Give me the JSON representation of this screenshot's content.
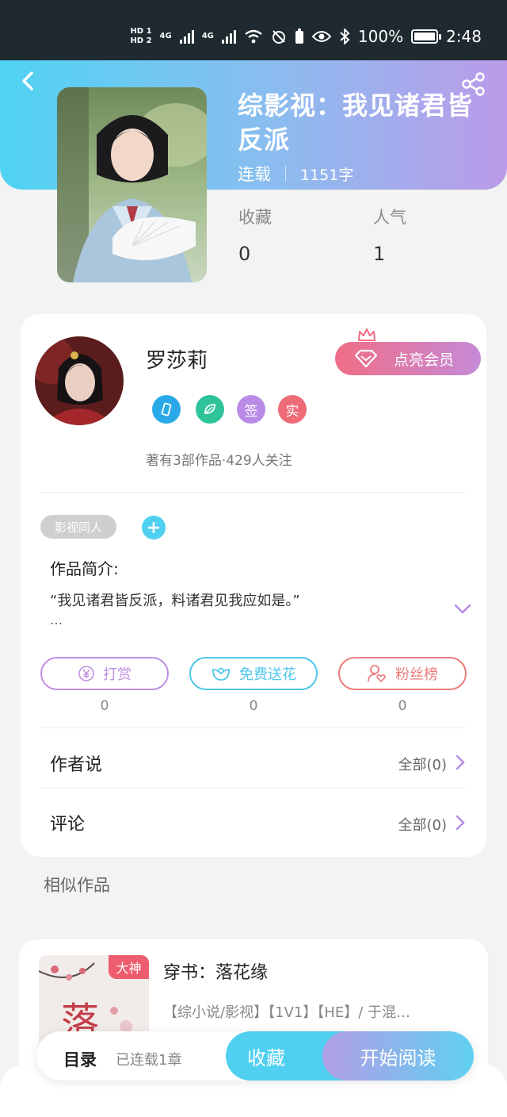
{
  "status_bar": {
    "sim1": "HD 1",
    "sim2": "HD 2",
    "net1": "4G",
    "net2": "4G",
    "battery": "100%",
    "time": "2:48"
  },
  "book": {
    "title": "综影视：我见诸君皆反派",
    "status": "连载",
    "words": "1151字",
    "stats": [
      {
        "label": "收藏",
        "value": "0"
      },
      {
        "label": "人气",
        "value": "1"
      }
    ]
  },
  "author": {
    "name": "罗莎莉",
    "vip_button": "点亮会员",
    "badges": [
      {
        "icon": "phone-badge-icon",
        "color": "#2aa9e8"
      },
      {
        "icon": "leaf-badge-icon",
        "color": "#2fc39a"
      },
      {
        "text": "签",
        "color": "#b98be6"
      },
      {
        "text": "实",
        "color": "#ee6b78"
      }
    ],
    "stats": "著有3部作品·429人关注"
  },
  "tags": [
    "影视同人"
  ],
  "intro": {
    "title": "作品简介:",
    "text": "“我见诸君皆反派，料诸君见我应如是。”",
    "ellipsis": "…"
  },
  "actions": [
    {
      "label": "打赏",
      "count": "0",
      "color": "#c08fe0",
      "icon": "yuan-icon"
    },
    {
      "label": "免费送花",
      "count": "0",
      "color": "#4fc6ec",
      "icon": "flower-icon"
    },
    {
      "label": "粉丝榜",
      "count": "0",
      "color": "#ec7b7b",
      "icon": "fans-icon"
    }
  ],
  "author_says": {
    "title": "作者说",
    "all": "全部(0)"
  },
  "comments": {
    "title": "评论",
    "all": "全部(0)"
  },
  "similar": {
    "label": "相似作品",
    "items": [
      {
        "tag": "大神",
        "title": "穿书：落花缘",
        "desc": "【综小说/影视】【1V1】【HE】/ 于混…"
      }
    ]
  },
  "bottom_bar": {
    "toc": "目录",
    "toc_sub": "已连载1章",
    "favorite": "收藏",
    "read": "开始阅读"
  },
  "colors": {
    "accent_cyan": "#4fd0f0",
    "accent_purple": "#bb9be9"
  }
}
